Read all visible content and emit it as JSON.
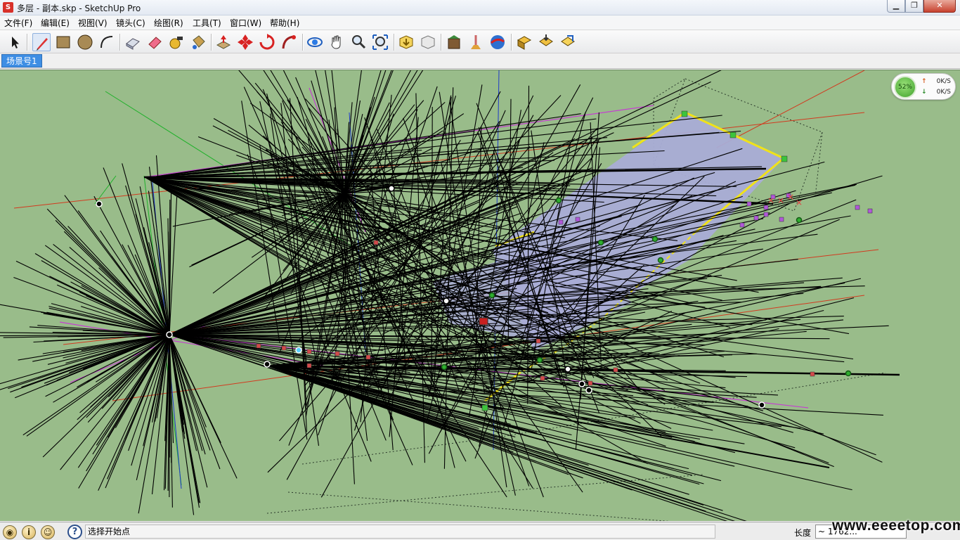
{
  "window": {
    "title": "多层 - 副本.skp - SketchUp Pro",
    "controls": {
      "minimize": "▁",
      "maximize": "❐",
      "close": "✕"
    }
  },
  "menu": {
    "items": [
      {
        "label": "文件(F)"
      },
      {
        "label": "编辑(E)"
      },
      {
        "label": "视图(V)"
      },
      {
        "label": "镜头(C)"
      },
      {
        "label": "绘图(R)"
      },
      {
        "label": "工具(T)"
      },
      {
        "label": "窗口(W)"
      },
      {
        "label": "帮助(H)"
      }
    ]
  },
  "toolbar": {
    "tools": [
      {
        "icon": "select-arrow-icon"
      },
      {
        "icon": "pencil-line-icon",
        "active": true
      },
      {
        "icon": "rectangle-icon"
      },
      {
        "icon": "circle-icon"
      },
      {
        "icon": "arc-icon"
      },
      {
        "icon": "make-component-icon"
      },
      {
        "icon": "eraser-icon"
      },
      {
        "icon": "tape-measure-icon"
      },
      {
        "icon": "paint-bucket-icon"
      },
      {
        "icon": "push-pull-icon"
      },
      {
        "icon": "move-icon"
      },
      {
        "icon": "rotate-icon"
      },
      {
        "icon": "follow-me-icon"
      },
      {
        "icon": "orbit-icon"
      },
      {
        "icon": "pan-hand-icon"
      },
      {
        "icon": "zoom-icon"
      },
      {
        "icon": "zoom-extents-icon"
      },
      {
        "icon": "get-models-icon"
      },
      {
        "icon": "share-model-icon"
      },
      {
        "icon": "component-warehouse-icon"
      },
      {
        "icon": "extension-icon"
      },
      {
        "icon": "send-to-google-earth-icon"
      },
      {
        "icon": "section-plane-icon"
      },
      {
        "icon": "section-cut-icon"
      },
      {
        "icon": "export-icon"
      }
    ]
  },
  "scenes": {
    "active_tab": "场景号1"
  },
  "netspeed": {
    "percent": "52%",
    "up_arrow": "↑",
    "up_value": "0K/S",
    "down_arrow": "↓",
    "down_value": "0K/S"
  },
  "statusbar": {
    "icons": [
      "geo-location-icon",
      "credits-icon",
      "sign-in-icon"
    ],
    "help_glyph": "?",
    "instruction": "选择开始点",
    "measure_label": "长度",
    "measure_value": "~ 1762..."
  },
  "watermark": "www.eeeetop.com",
  "colors": {
    "viewport_bg": "#99bc8a",
    "scene_tab_bg": "#3e8ee4",
    "face_fill": "#a9acd6",
    "face_edge": "#f0e21a",
    "red_axis": "#d23a1f",
    "green_axis": "#1fb12a",
    "blue_axis": "#1e3ac8"
  }
}
